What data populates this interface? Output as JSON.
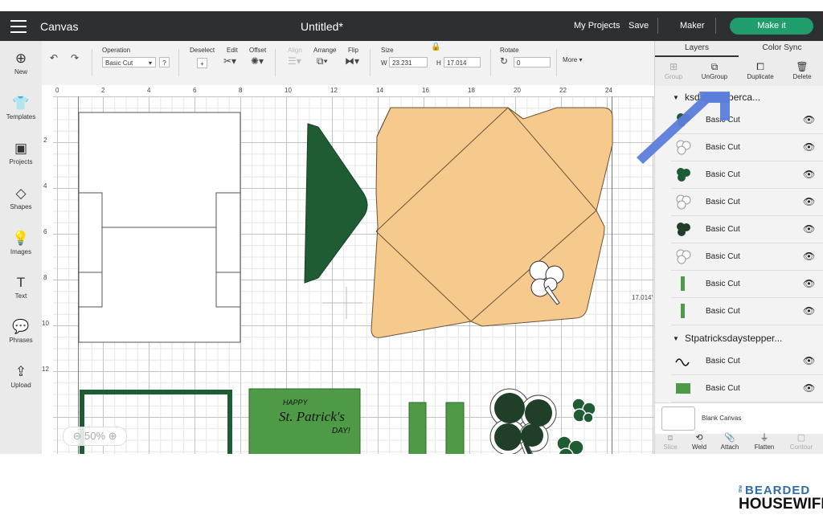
{
  "topbar": {
    "app_name": "Canvas",
    "doc_title": "Untitled*",
    "my_projects": "My Projects",
    "save": "Save",
    "machine": "Maker",
    "make_it": "Make it"
  },
  "toolbar": {
    "operation_label": "Operation",
    "operation_value": "Basic Cut",
    "deselect": "Deselect",
    "edit": "Edit",
    "offset": "Offset",
    "align": "Align",
    "arrange": "Arrange",
    "flip": "Flip",
    "size": "Size",
    "w_label": "W",
    "w_value": "23.231",
    "h_label": "H",
    "h_value": "17.014",
    "rotate": "Rotate",
    "rotate_value": "0",
    "more": "More"
  },
  "sidebar": {
    "items": [
      {
        "label": "New",
        "icon": "plus-circle-icon"
      },
      {
        "label": "Templates",
        "icon": "shirt-icon"
      },
      {
        "label": "Projects",
        "icon": "projects-icon"
      },
      {
        "label": "Shapes",
        "icon": "shapes-icon"
      },
      {
        "label": "Images",
        "icon": "lightbulb-icon"
      },
      {
        "label": "Text",
        "icon": "text-icon"
      },
      {
        "label": "Phrases",
        "icon": "speech-bubble-icon"
      },
      {
        "label": "Upload",
        "icon": "upload-icon"
      }
    ]
  },
  "ruler": {
    "top": [
      "0",
      "2",
      "4",
      "6",
      "8",
      "10",
      "12",
      "14",
      "16",
      "18",
      "20",
      "22",
      "24"
    ],
    "left": [
      "2",
      "4",
      "6",
      "8",
      "10",
      "12"
    ]
  },
  "canvas": {
    "zoom": "50%",
    "height_readout": "17.014'",
    "card_text_1": "HAPPY",
    "card_text_2": "St. Patrick's",
    "card_text_3": "DAY!"
  },
  "panel": {
    "tab_layers": "Layers",
    "tab_color_sync": "Color Sync",
    "actions": {
      "group": "Group",
      "ungroup": "UnGroup",
      "duplicate": "Duplicate",
      "delete": "Delete"
    },
    "groups": [
      {
        "name": "ksdaysteppercа...",
        "layers": [
          {
            "name": "Basic Cut",
            "thumb": "dark-shamrock"
          },
          {
            "name": "Basic Cut",
            "thumb": "white-shamrock"
          },
          {
            "name": "Basic Cut",
            "thumb": "dark-shamrock"
          },
          {
            "name": "Basic Cut",
            "thumb": "white-shamrock"
          },
          {
            "name": "Basic Cut",
            "thumb": "dark-shamrock"
          },
          {
            "name": "Basic Cut",
            "thumb": "white-shamrock"
          },
          {
            "name": "Basic Cut",
            "thumb": "green-bar"
          },
          {
            "name": "Basic Cut",
            "thumb": "green-bar"
          }
        ]
      },
      {
        "name": "Stpatricksdaystepper...",
        "layers": [
          {
            "name": "Basic Cut",
            "thumb": "script-text"
          },
          {
            "name": "Basic Cut",
            "thumb": "green-rect"
          }
        ]
      }
    ],
    "blank_canvas": "Blank Canvas",
    "bottom": {
      "slice": "Slice",
      "weld": "Weld",
      "attach": "Attach",
      "flatten": "Flatten",
      "contour": "Contour"
    }
  },
  "colors": {
    "dark_green": "#1f5c34",
    "medium_green": "#4f9a47",
    "envelope_tan": "#f6c98d",
    "accent_blue": "#5b7ddb",
    "make_it_green": "#1f9e6b"
  },
  "logo": {
    "the": "the",
    "bearded": "BEARDED",
    "housewife": "HOUSEWIFE"
  }
}
